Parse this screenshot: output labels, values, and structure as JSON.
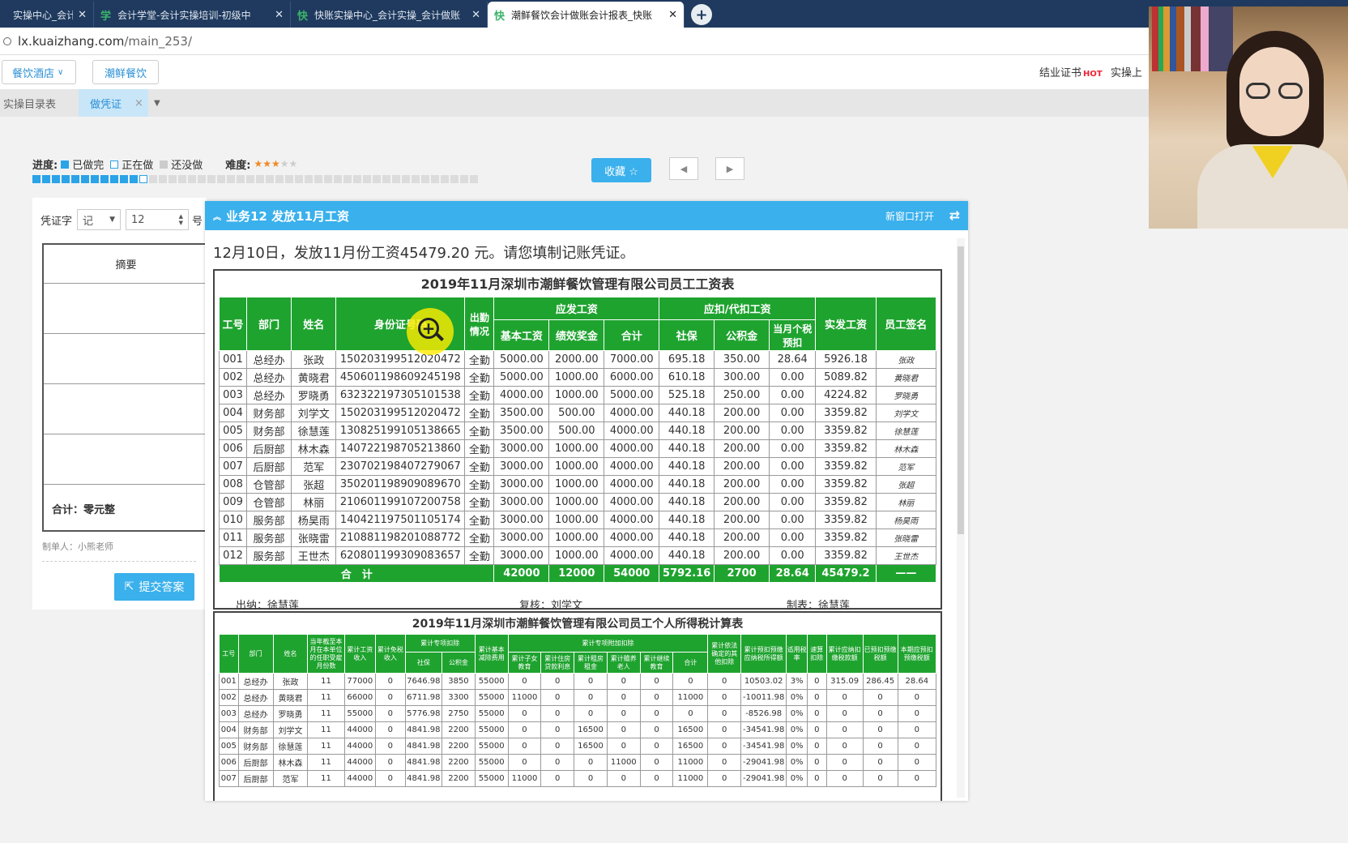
{
  "browser": {
    "tabs": [
      {
        "icon": "",
        "label": "实操中心_会计实操",
        "active": false
      },
      {
        "icon": "学",
        "label": "会计学堂-会计实操培训-初级中",
        "active": false
      },
      {
        "icon": "快",
        "label": "快账实操中心_会计实操_会计做账",
        "active": false
      },
      {
        "icon": "快",
        "label": "潮鲜餐饮会计做账会计报表_快账",
        "active": true
      }
    ],
    "url_domain": "lx.kuaizhang.com",
    "url_path": "/main_253/"
  },
  "topnav": {
    "industry": "餐饮酒店",
    "company": "潮鲜餐饮",
    "cert": "结业证书",
    "hot": "HOT",
    "practice": "实操上"
  },
  "subtabs": {
    "catalog": "实操目录表",
    "voucher": "做凭证"
  },
  "progress": {
    "label": "进度:",
    "done": "已做完",
    "doing": "正在做",
    "todo": "还没做",
    "difficulty_label": "难度:",
    "difficulty": 3,
    "difficulty_max": 5,
    "done_count": 11,
    "total_count": 46
  },
  "fav_label": "收藏 ☆",
  "voucher": {
    "type_label": "凭证字",
    "type_value": "记",
    "number": "12",
    "number_suffix": "号",
    "summary_header": "摘要",
    "total_label": "合计：零元整",
    "maker": "制单人：小熊老师",
    "submit": "提交答案"
  },
  "business": {
    "title": "业务12 发放11月工资",
    "open_new": "新窗口打开",
    "question": "12月10日，发放11月份工资45479.20 元。请您填制记账凭证。"
  },
  "payroll": {
    "title": "2019年11月深圳市潮鲜餐饮管理有限公司员工工资表",
    "headers": {
      "id": "工号",
      "dept": "部门",
      "name": "姓名",
      "idcard": "身份证号码",
      "attendance": "出勤情况",
      "payable": "应发工资",
      "base": "基本工资",
      "bonus": "绩效奖金",
      "sum": "合计",
      "deduct": "应扣/代扣工资",
      "social": "社保",
      "fund": "公积金",
      "tax": "当月个税预扣",
      "net": "实发工资",
      "sign": "员工签名"
    },
    "rows": [
      [
        "001",
        "总经办",
        "张政",
        "150203199512020472",
        "全勤",
        "5000.00",
        "2000.00",
        "7000.00",
        "695.18",
        "350.00",
        "28.64",
        "5926.18",
        "张政"
      ],
      [
        "002",
        "总经办",
        "黄晓君",
        "450601198609245198",
        "全勤",
        "5000.00",
        "1000.00",
        "6000.00",
        "610.18",
        "300.00",
        "0.00",
        "5089.82",
        "黄晓君"
      ],
      [
        "003",
        "总经办",
        "罗晓勇",
        "632322197305101538",
        "全勤",
        "4000.00",
        "1000.00",
        "5000.00",
        "525.18",
        "250.00",
        "0.00",
        "4224.82",
        "罗晓勇"
      ],
      [
        "004",
        "财务部",
        "刘学文",
        "150203199512020472",
        "全勤",
        "3500.00",
        "500.00",
        "4000.00",
        "440.18",
        "200.00",
        "0.00",
        "3359.82",
        "刘学文"
      ],
      [
        "005",
        "财务部",
        "徐慧莲",
        "130825199105138665",
        "全勤",
        "3500.00",
        "500.00",
        "4000.00",
        "440.18",
        "200.00",
        "0.00",
        "3359.82",
        "徐慧莲"
      ],
      [
        "006",
        "后厨部",
        "林木森",
        "140722198705213860",
        "全勤",
        "3000.00",
        "1000.00",
        "4000.00",
        "440.18",
        "200.00",
        "0.00",
        "3359.82",
        "林木森"
      ],
      [
        "007",
        "后厨部",
        "范军",
        "230702198407279067",
        "全勤",
        "3000.00",
        "1000.00",
        "4000.00",
        "440.18",
        "200.00",
        "0.00",
        "3359.82",
        "范军"
      ],
      [
        "008",
        "仓管部",
        "张超",
        "350201198909089670",
        "全勤",
        "3000.00",
        "1000.00",
        "4000.00",
        "440.18",
        "200.00",
        "0.00",
        "3359.82",
        "张超"
      ],
      [
        "009",
        "仓管部",
        "林丽",
        "210601199107200758",
        "全勤",
        "3000.00",
        "1000.00",
        "4000.00",
        "440.18",
        "200.00",
        "0.00",
        "3359.82",
        "林丽"
      ],
      [
        "010",
        "服务部",
        "杨昊雨",
        "140421197501105174",
        "全勤",
        "3000.00",
        "1000.00",
        "4000.00",
        "440.18",
        "200.00",
        "0.00",
        "3359.82",
        "杨昊雨"
      ],
      [
        "011",
        "服务部",
        "张晓雷",
        "210881198201088772",
        "全勤",
        "3000.00",
        "1000.00",
        "4000.00",
        "440.18",
        "200.00",
        "0.00",
        "3359.82",
        "张晓雷"
      ],
      [
        "012",
        "服务部",
        "王世杰",
        "620801199309083657",
        "全勤",
        "3000.00",
        "1000.00",
        "4000.00",
        "440.18",
        "200.00",
        "0.00",
        "3359.82",
        "王世杰"
      ]
    ],
    "total": {
      "label": "合　计",
      "base": "42000",
      "bonus": "12000",
      "sum": "54000",
      "social": "5792.16",
      "fund": "2700",
      "tax": "28.64",
      "net": "45479.2",
      "sign": "——"
    },
    "cashier": "出纳：徐慧莲",
    "reviewer": "复核：刘学文",
    "preparer": "制表：徐慧莲"
  },
  "taxsheet": {
    "title": "2019年11月深圳市潮鲜餐饮管理有限公司员工个人所得税计算表",
    "headers": [
      "工号",
      "部门",
      "姓名",
      "当年截至本月在本单位的任职受雇月份数",
      "累计工资收入",
      "累计免税收入",
      "社保",
      "公积金",
      "累计基本减除费用",
      "累计子女教育",
      "累计住房贷款利息",
      "累计租房租金",
      "累计赡养老人",
      "累计继续教育",
      "合计",
      "累计依法确定的其他扣除",
      "累计预扣预缴应纳税所得额",
      "适用税率",
      "速算扣除",
      "累计应纳扣缴税款额",
      "已预扣预缴税额",
      "本期应预扣预缴税额"
    ],
    "group_special": "累计专项扣除",
    "group_additional": "累计专项附加扣除",
    "rows": [
      [
        "001",
        "总经办",
        "张政",
        "11",
        "77000",
        "0",
        "7646.98",
        "3850",
        "55000",
        "0",
        "0",
        "0",
        "0",
        "0",
        "0",
        "0",
        "10503.02",
        "3%",
        "0",
        "315.09",
        "286.45",
        "28.64"
      ],
      [
        "002",
        "总经办",
        "黄晓君",
        "11",
        "66000",
        "0",
        "6711.98",
        "3300",
        "55000",
        "11000",
        "0",
        "0",
        "0",
        "0",
        "11000",
        "0",
        "-10011.98",
        "0%",
        "0",
        "0",
        "0",
        "0"
      ],
      [
        "003",
        "总经办",
        "罗晓勇",
        "11",
        "55000",
        "0",
        "5776.98",
        "2750",
        "55000",
        "0",
        "0",
        "0",
        "0",
        "0",
        "0",
        "0",
        "-8526.98",
        "0%",
        "0",
        "0",
        "0",
        "0"
      ],
      [
        "004",
        "财务部",
        "刘学文",
        "11",
        "44000",
        "0",
        "4841.98",
        "2200",
        "55000",
        "0",
        "0",
        "16500",
        "0",
        "0",
        "16500",
        "0",
        "-34541.98",
        "0%",
        "0",
        "0",
        "0",
        "0"
      ],
      [
        "005",
        "财务部",
        "徐慧莲",
        "11",
        "44000",
        "0",
        "4841.98",
        "2200",
        "55000",
        "0",
        "0",
        "16500",
        "0",
        "0",
        "16500",
        "0",
        "-34541.98",
        "0%",
        "0",
        "0",
        "0",
        "0"
      ],
      [
        "006",
        "后厨部",
        "林木森",
        "11",
        "44000",
        "0",
        "4841.98",
        "2200",
        "55000",
        "0",
        "0",
        "0",
        "11000",
        "0",
        "11000",
        "0",
        "-29041.98",
        "0%",
        "0",
        "0",
        "0",
        "0"
      ],
      [
        "007",
        "后厨部",
        "范军",
        "11",
        "44000",
        "0",
        "4841.98",
        "2200",
        "55000",
        "11000",
        "0",
        "0",
        "0",
        "0",
        "11000",
        "0",
        "-29041.98",
        "0%",
        "0",
        "0",
        "0",
        "0"
      ]
    ]
  },
  "colors": {
    "accent": "#3ab0ec",
    "table_green": "#1fa32f",
    "tab_bar": "#1f3a5e"
  }
}
